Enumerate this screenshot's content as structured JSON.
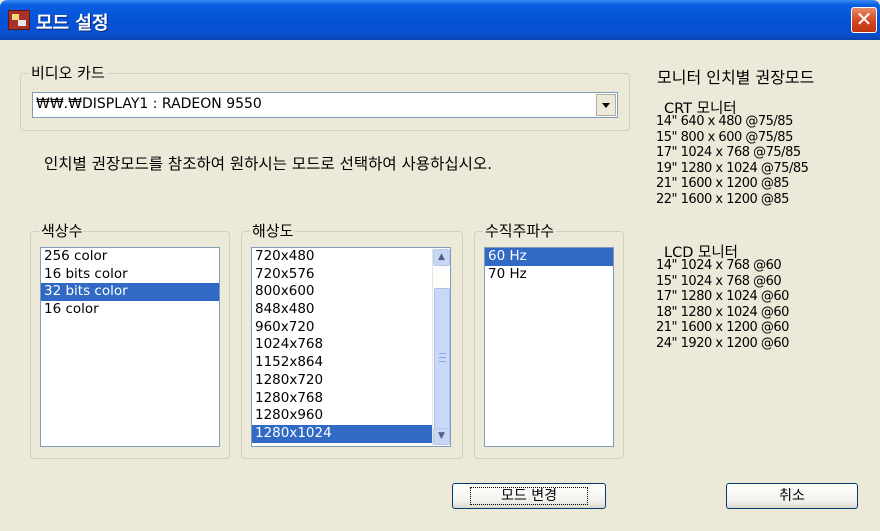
{
  "window": {
    "title": "모드 설정"
  },
  "video_card": {
    "label": "비디오 카드",
    "selected": "₩₩.₩DISPLAY1 : RADEON 9550"
  },
  "instruction": "인치별 권장모드를 참조하여 원하시는 모드로 선택하여 사용하십시오.",
  "colors_group": {
    "label": "색상수",
    "items": [
      "256 color",
      "16 bits color",
      "32 bits color",
      "16 color"
    ],
    "selected_index": 2
  },
  "resolution_group": {
    "label": "해상도",
    "items": [
      "720x480",
      "720x576",
      "800x600",
      "848x480",
      "960x720",
      "1024x768",
      "1152x864",
      "1280x720",
      "1280x768",
      "1280x960",
      "1280x1024"
    ],
    "selected_index": 10
  },
  "refresh_group": {
    "label": "수직주파수",
    "items": [
      "60 Hz",
      "70 Hz"
    ],
    "selected_index": 0
  },
  "recommended": {
    "title": "모니터 인치별 권장모드",
    "crt_heading": "CRT 모니터",
    "crt_modes": [
      "14\" 640 x 480 @75/85",
      "15\" 800 x 600 @75/85",
      "17\" 1024 x 768 @75/85",
      "19\" 1280 x 1024 @75/85",
      "21\" 1600 x 1200 @85",
      "22\" 1600 x 1200 @85"
    ],
    "lcd_heading": "LCD 모니터",
    "lcd_modes": [
      "14\" 1024 x 768 @60",
      "15\" 1024 x 768 @60",
      "17\" 1280 x 1024 @60",
      "18\" 1280 x 1024 @60",
      "21\" 1600 x 1200 @60",
      "24\" 1920 x 1200 @60"
    ]
  },
  "buttons": {
    "change_mode": "모드 변경",
    "cancel": "취소"
  }
}
